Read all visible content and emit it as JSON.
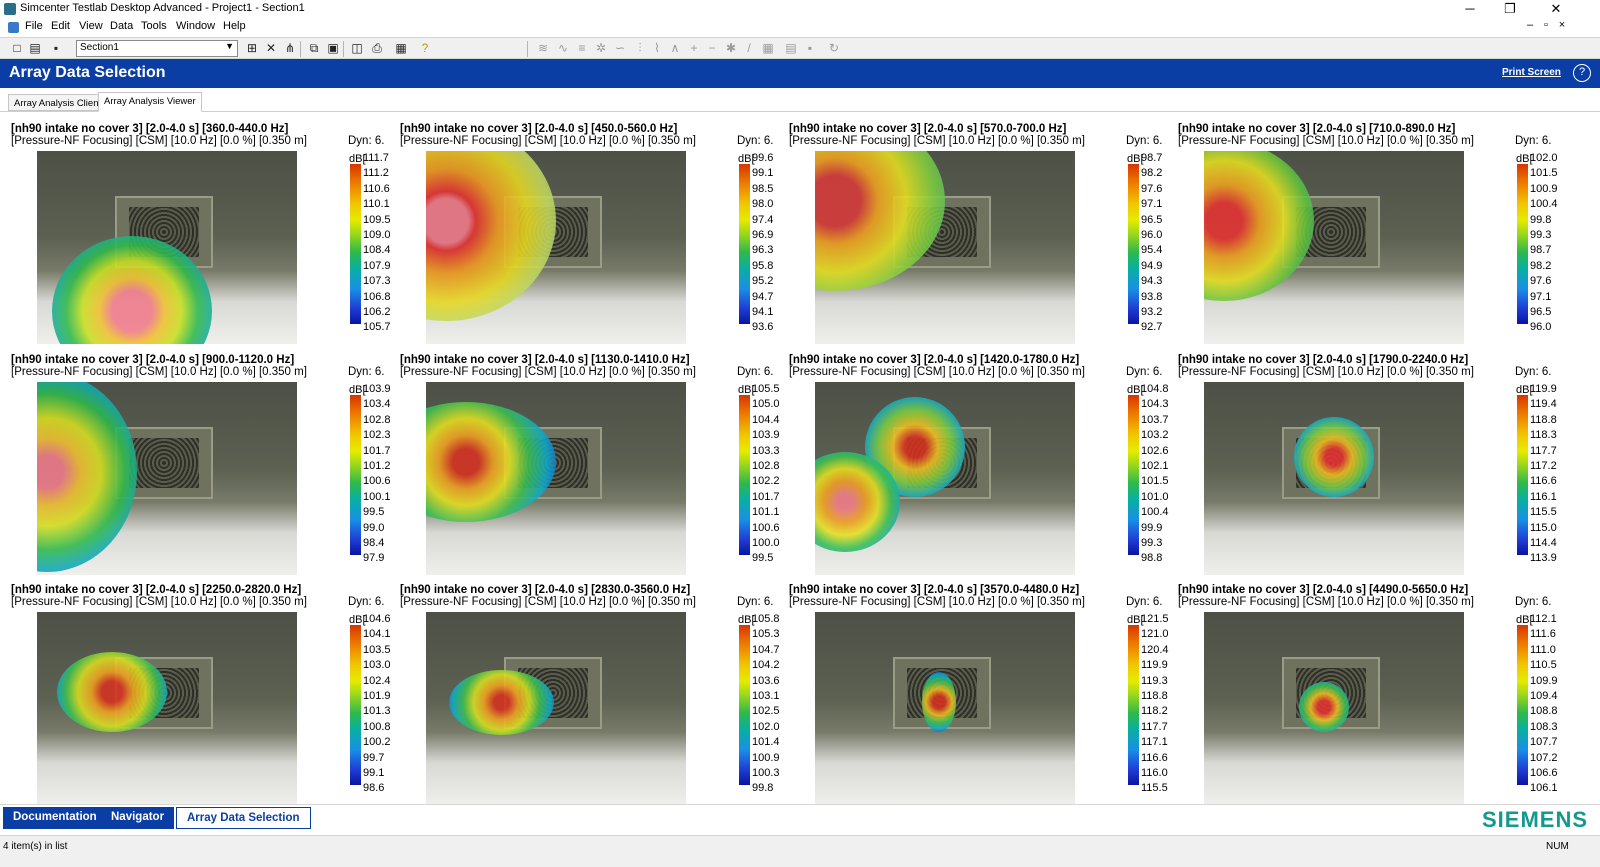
{
  "window": {
    "title": "Simcenter Testlab Desktop Advanced - Project1 - Section1",
    "minimize": "─",
    "maximize": "❐",
    "close": "✕"
  },
  "menu": {
    "items": [
      "File",
      "Edit",
      "View",
      "Data",
      "Tools",
      "Window",
      "Help"
    ],
    "mdi_minimize": "–",
    "mdi_restore": "▫",
    "mdi_close": "×"
  },
  "toolbar": {
    "section_value": "Section1"
  },
  "header": {
    "title": "Array Data Selection",
    "print_screen": "Print Screen",
    "help": "?"
  },
  "tabs": [
    "Array Analysis Client",
    "Array Analysis Viewer"
  ],
  "panels": [
    {
      "title": "[nh90 intake no cover 3] [2.0-4.0 s] [360.0-440.0 Hz]",
      "subtitle": "[Pressure-NF Focusing] [CSM] [10.0 Hz] [0.0 %] [0.350 m]",
      "dyn": "Dyn: 6.",
      "unit": "dB[",
      "ticks": [
        "111.7",
        "111.2",
        "110.6",
        "110.1",
        "109.5",
        "109.0",
        "108.4",
        "107.9",
        "107.3",
        "106.8",
        "106.2",
        "105.7"
      ]
    },
    {
      "title": "[nh90 intake no cover 3] [2.0-4.0 s] [450.0-560.0 Hz]",
      "subtitle": "[Pressure-NF Focusing] [CSM] [10.0 Hz] [0.0 %] [0.350 m]",
      "dyn": "Dyn: 6.",
      "unit": "dB[",
      "ticks": [
        "99.6",
        "99.1",
        "98.5",
        "98.0",
        "97.4",
        "96.9",
        "96.3",
        "95.8",
        "95.2",
        "94.7",
        "94.1",
        "93.6"
      ]
    },
    {
      "title": "[nh90 intake no cover 3] [2.0-4.0 s] [570.0-700.0 Hz]",
      "subtitle": "[Pressure-NF Focusing] [CSM] [10.0 Hz] [0.0 %] [0.350 m]",
      "dyn": "Dyn: 6.",
      "unit": "dB[",
      "ticks": [
        "98.7",
        "98.2",
        "97.6",
        "97.1",
        "96.5",
        "96.0",
        "95.4",
        "94.9",
        "94.3",
        "93.8",
        "93.2",
        "92.7"
      ]
    },
    {
      "title": "[nh90 intake no cover 3] [2.0-4.0 s] [710.0-890.0 Hz]",
      "subtitle": "[Pressure-NF Focusing] [CSM] [10.0 Hz] [0.0 %] [0.350 m]",
      "dyn": "Dyn: 6.",
      "unit": "dB[",
      "ticks": [
        "102.0",
        "101.5",
        "100.9",
        "100.4",
        "99.8",
        "99.3",
        "98.7",
        "98.2",
        "97.6",
        "97.1",
        "96.5",
        "96.0"
      ]
    },
    {
      "title": "[nh90 intake no cover 3] [2.0-4.0 s] [900.0-1120.0 Hz]",
      "subtitle": "[Pressure-NF Focusing] [CSM] [10.0 Hz] [0.0 %] [0.350 m]",
      "dyn": "Dyn: 6.",
      "unit": "dB[",
      "ticks": [
        "103.9",
        "103.4",
        "102.8",
        "102.3",
        "101.7",
        "101.2",
        "100.6",
        "100.1",
        "99.5",
        "99.0",
        "98.4",
        "97.9"
      ]
    },
    {
      "title": "[nh90 intake no cover 3] [2.0-4.0 s] [1130.0-1410.0 Hz]",
      "subtitle": "[Pressure-NF Focusing] [CSM] [10.0 Hz] [0.0 %] [0.350 m]",
      "dyn": "Dyn: 6.",
      "unit": "dB[",
      "ticks": [
        "105.5",
        "105.0",
        "104.4",
        "103.9",
        "103.3",
        "102.8",
        "102.2",
        "101.7",
        "101.1",
        "100.6",
        "100.0",
        "99.5"
      ]
    },
    {
      "title": "[nh90 intake no cover 3] [2.0-4.0 s] [1420.0-1780.0 Hz]",
      "subtitle": "[Pressure-NF Focusing] [CSM] [10.0 Hz] [0.0 %] [0.350 m]",
      "dyn": "Dyn: 6.",
      "unit": "dB[",
      "ticks": [
        "104.8",
        "104.3",
        "103.7",
        "103.2",
        "102.6",
        "102.1",
        "101.5",
        "101.0",
        "100.4",
        "99.9",
        "99.3",
        "98.8"
      ]
    },
    {
      "title": "[nh90 intake no cover 3] [2.0-4.0 s] [1790.0-2240.0 Hz]",
      "subtitle": "[Pressure-NF Focusing] [CSM] [10.0 Hz] [0.0 %] [0.350 m]",
      "dyn": "Dyn: 6.",
      "unit": "dB[",
      "ticks": [
        "119.9",
        "119.4",
        "118.8",
        "118.3",
        "117.7",
        "117.2",
        "116.6",
        "116.1",
        "115.5",
        "115.0",
        "114.4",
        "113.9"
      ]
    },
    {
      "title": "[nh90 intake no cover 3] [2.0-4.0 s] [2250.0-2820.0 Hz]",
      "subtitle": "[Pressure-NF Focusing] [CSM] [10.0 Hz] [0.0 %] [0.350 m]",
      "dyn": "Dyn: 6.",
      "unit": "dB[",
      "ticks": [
        "104.6",
        "104.1",
        "103.5",
        "103.0",
        "102.4",
        "101.9",
        "101.3",
        "100.8",
        "100.2",
        "99.7",
        "99.1",
        "98.6"
      ]
    },
    {
      "title": "[nh90 intake no cover 3] [2.0-4.0 s] [2830.0-3560.0 Hz]",
      "subtitle": "[Pressure-NF Focusing] [CSM] [10.0 Hz] [0.0 %] [0.350 m]",
      "dyn": "Dyn: 6.",
      "unit": "dB[",
      "ticks": [
        "105.8",
        "105.3",
        "104.7",
        "104.2",
        "103.6",
        "103.1",
        "102.5",
        "102.0",
        "101.4",
        "100.9",
        "100.3",
        "99.8"
      ]
    },
    {
      "title": "[nh90 intake no cover 3] [2.0-4.0 s] [3570.0-4480.0 Hz]",
      "subtitle": "[Pressure-NF Focusing] [CSM] [10.0 Hz] [0.0 %] [0.350 m]",
      "dyn": "Dyn: 6.",
      "unit": "dB[",
      "ticks": [
        "121.5",
        "121.0",
        "120.4",
        "119.9",
        "119.3",
        "118.8",
        "118.2",
        "117.7",
        "117.1",
        "116.6",
        "116.0",
        "115.5"
      ]
    },
    {
      "title": "[nh90 intake no cover 3] [2.0-4.0 s] [4490.0-5650.0 Hz]",
      "subtitle": "[Pressure-NF Focusing] [CSM] [10.0 Hz] [0.0 %] [0.350 m]",
      "dyn": "Dyn: 6.",
      "unit": "dB[",
      "ticks": [
        "112.1",
        "111.6",
        "111.0",
        "110.5",
        "109.9",
        "109.4",
        "108.8",
        "108.3",
        "107.7",
        "107.2",
        "106.6",
        "106.1"
      ]
    }
  ],
  "bottom_nav": {
    "documentation": "Documentation",
    "navigator": "Navigator",
    "array_data_selection": "Array Data Selection",
    "logo": "SIEMENS"
  },
  "status": {
    "text": "4 item(s) in list",
    "num": "NUM"
  },
  "colors": {
    "header_blue": "#0a3ea5",
    "siemens_teal": "#14998f"
  }
}
